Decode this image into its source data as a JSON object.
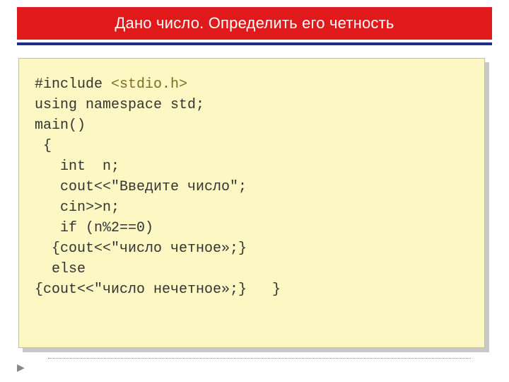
{
  "title": "Дано  число. Определить его четность",
  "code": {
    "l1a": "#include ",
    "l1b": "<stdio.h>",
    "l2": "using namespace std;",
    "l3": "main()",
    "l4": " {",
    "l5": "   int  n;",
    "l6": "   cout<<\"Введите число\";",
    "l7": "   cin>>n;",
    "l8": "   if (n%2==0)",
    "l9": "  {cout<<\"число четное»;}",
    "l10": "  else",
    "l11": "{cout<<\"число нечетное»;}   }"
  },
  "arrow_glyph": "▶"
}
